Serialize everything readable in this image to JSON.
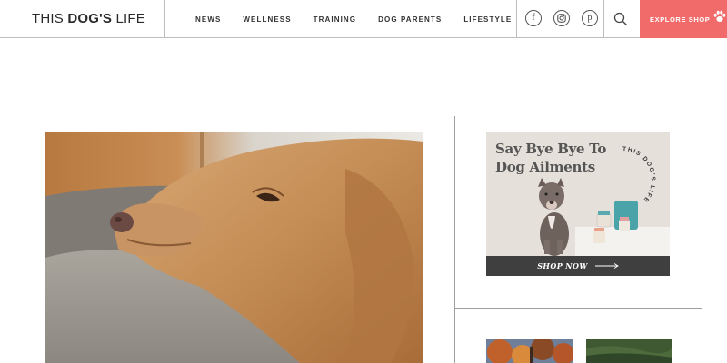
{
  "header": {
    "logo": {
      "part1": "THIS ",
      "part2": "DOG'S",
      "part3": " LIFE"
    },
    "nav": [
      "NEWS",
      "WELLNESS",
      "TRAINING",
      "DOG PARENTS",
      "LIFESTYLE"
    ],
    "social": [
      {
        "icon": "facebook-icon",
        "glyph": "f"
      },
      {
        "icon": "instagram-icon"
      },
      {
        "icon": "pinterest-icon",
        "glyph": "p"
      }
    ],
    "search_icon": "search-icon",
    "cta_label": "EXPLORE SHOP",
    "colors": {
      "cta_bg": "#f26b6b",
      "border": "#bdbdbd"
    }
  },
  "hero": {
    "image": "golden-retriever-resting-on-couch-photo"
  },
  "sidebar": {
    "ad": {
      "title_line1": "Say Bye Bye To",
      "title_line2": "Dog Ailments",
      "badge_text": "THIS DOG'S LIFE",
      "cta": "SHOP NOW",
      "colors": {
        "background": "#e6e0da",
        "bar": "#3f3f3f"
      }
    },
    "thumbnails": [
      "autumn-trees-photo",
      "green-grass-photo"
    ]
  }
}
